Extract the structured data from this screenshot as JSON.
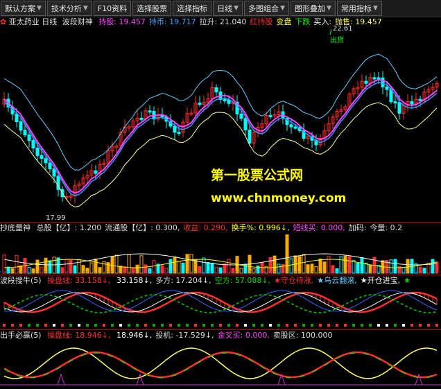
{
  "toolbar": {
    "items": [
      {
        "label": "默认方案",
        "has_dropdown": true
      },
      {
        "label": "技术分析",
        "has_dropdown": true
      },
      {
        "label": "F10资料",
        "has_dropdown": false
      },
      {
        "label": "选择股票",
        "has_dropdown": false
      },
      {
        "label": "选择指标",
        "has_dropdown": false
      },
      {
        "label": "日线",
        "has_dropdown": true
      },
      {
        "label": "多图组合",
        "has_dropdown": true
      },
      {
        "label": "图形叠加",
        "has_dropdown": true
      },
      {
        "label": "常用指标",
        "has_dropdown": true
      }
    ]
  },
  "main_panel": {
    "stock_name": "亚太药业",
    "period": "日线",
    "indicator": "波段财神",
    "fields": [
      {
        "label": "持股:",
        "value": "19.457",
        "color": "#ff44ff"
      },
      {
        "label": "持币:",
        "value": "19.717",
        "color": "#44aaff"
      },
      {
        "label": "拉升:",
        "value": "21.040",
        "color": "#dddddd"
      },
      {
        "label": "红持股",
        "value": "",
        "color": "#ff3030"
      },
      {
        "label": "变盘",
        "value": "",
        "color": "#ffff00"
      },
      {
        "label": "下跌",
        "value": "",
        "color": "#00ff00"
      },
      {
        "label": "买入:",
        "value": "",
        "color": "#ffffff"
      },
      {
        "label": "抛售:",
        "value": "19.457",
        "color": "#ffff66"
      }
    ],
    "high_price": "22.61",
    "low_price": "17.99",
    "signal_label": "出货"
  },
  "watermark": {
    "title": "第一股票公式网",
    "url": "www.chnmoney.com"
  },
  "volume_panel": {
    "indicator": "抄底量神",
    "fields": [
      {
        "label": "总股【亿】:",
        "value": "1.200",
        "color": "#dddddd"
      },
      {
        "label": "流通股【亿】:",
        "value": "0.300,",
        "color": "#dddddd"
      },
      {
        "label": "收益:",
        "value": "0.290,",
        "color": "#ff3030"
      },
      {
        "label": "换手%:",
        "value": "0.996↓,",
        "color": "#ffff00"
      },
      {
        "label": "短线买:",
        "value": "0.000,",
        "color": "#ff44ff"
      },
      {
        "label": "加码:",
        "value": "",
        "color": "#dddddd"
      },
      {
        "label": "今量:",
        "value": "0.2",
        "color": "#dddddd"
      }
    ]
  },
  "panel3": {
    "indicator": "波段搜牛(5)",
    "fields": [
      {
        "label": "操盘线:",
        "value": "33.158↓,",
        "color": "#ff3030"
      },
      {
        "label": "",
        "value": "33.158↓,",
        "color": "#ffffff"
      },
      {
        "label": "多方:",
        "value": "17.204↓,",
        "color": "#dddddd"
      },
      {
        "label": "空方:",
        "value": "57.088↓,",
        "color": "#00dd00"
      },
      {
        "label": "★守仓待涨,",
        "value": "",
        "color": "#ff3030"
      },
      {
        "label": "★乌云翻滚,",
        "value": "",
        "color": "#66ccff"
      },
      {
        "label": "★开仓进宝,",
        "value": "",
        "color": "#ffffff"
      },
      {
        "label": "★",
        "value": "",
        "color": "#00dd00"
      }
    ]
  },
  "panel4": {
    "indicator": "出手必赢(5)",
    "fields": [
      {
        "label": "操盘线:",
        "value": "18.946↓,",
        "color": "#ff3030"
      },
      {
        "label": "",
        "value": "18.946↓,",
        "color": "#ffffff"
      },
      {
        "label": "投机:",
        "value": "-17.529↓,",
        "color": "#dddddd"
      },
      {
        "label": "金叉买:",
        "value": "0.000,",
        "color": "#ff44ff"
      },
      {
        "label": "卖股区:",
        "value": "100.000",
        "color": "#dddddd"
      }
    ]
  },
  "colors": {
    "background": "#000000",
    "up_candle": "#ff3030",
    "down_candle": "#00ffff",
    "separator": "#b00000"
  }
}
